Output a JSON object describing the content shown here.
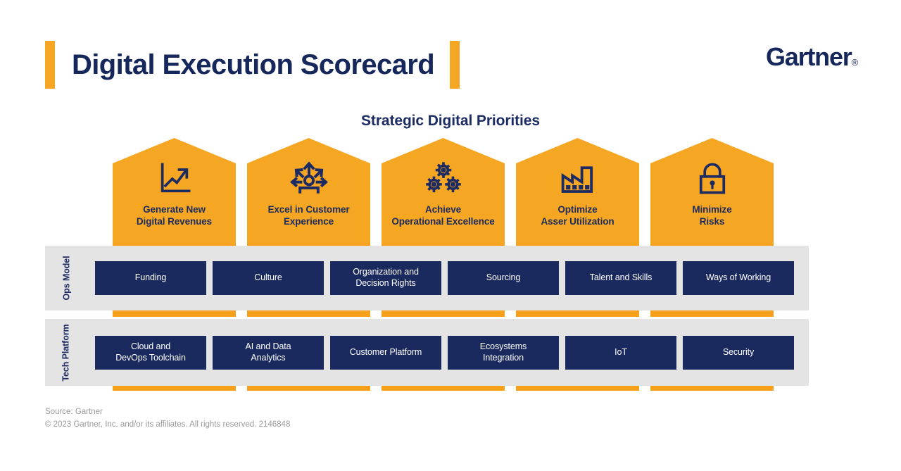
{
  "header": {
    "title": "Digital Execution Scorecard",
    "brand": "Gartner",
    "brand_mark": "®"
  },
  "section": {
    "heading": "Strategic Digital Priorities"
  },
  "colors": {
    "orange": "#F5A623",
    "orange_strip": "#F9A01B",
    "navy": "#1B2A5E",
    "navy_text": "#1C2B61",
    "band_gray": "#E4E4E4",
    "footer_gray": "#9A9A9A"
  },
  "priorities": [
    {
      "icon": "growth-chart-icon",
      "line1": "Generate New",
      "line2": "Digital Revenues"
    },
    {
      "icon": "customer-experience-icon",
      "line1": "Excel in Customer",
      "line2": "Experience"
    },
    {
      "icon": "gears-icon",
      "line1": "Achieve",
      "line2": "Operational Excellence"
    },
    {
      "icon": "factory-icon",
      "line1": "Optimize",
      "line2": "Asser Utilization"
    },
    {
      "icon": "lock-icon",
      "line1": "Minimize",
      "line2": "Risks"
    }
  ],
  "bands": [
    {
      "label": "Ops Model",
      "items": [
        {
          "line1": "Funding",
          "line2": ""
        },
        {
          "line1": "Culture",
          "line2": ""
        },
        {
          "line1": "Organization and",
          "line2": "Decision Rights"
        },
        {
          "line1": "Sourcing",
          "line2": ""
        },
        {
          "line1": "Talent and Skills",
          "line2": ""
        },
        {
          "line1": "Ways of Working",
          "line2": ""
        }
      ]
    },
    {
      "label": "Tech Platform",
      "items": [
        {
          "line1": "Cloud and",
          "line2": "DevOps Toolchain"
        },
        {
          "line1": "AI and Data",
          "line2": "Analytics"
        },
        {
          "line1": "Customer Platform",
          "line2": ""
        },
        {
          "line1": "Ecosystems",
          "line2": "Integration"
        },
        {
          "line1": "IoT",
          "line2": ""
        },
        {
          "line1": "Security",
          "line2": ""
        }
      ]
    }
  ],
  "footer": {
    "source": "Source: Gartner",
    "copyright": "© 2023 Gartner, Inc. and/or its affiliates. All rights reserved. 2146848"
  }
}
